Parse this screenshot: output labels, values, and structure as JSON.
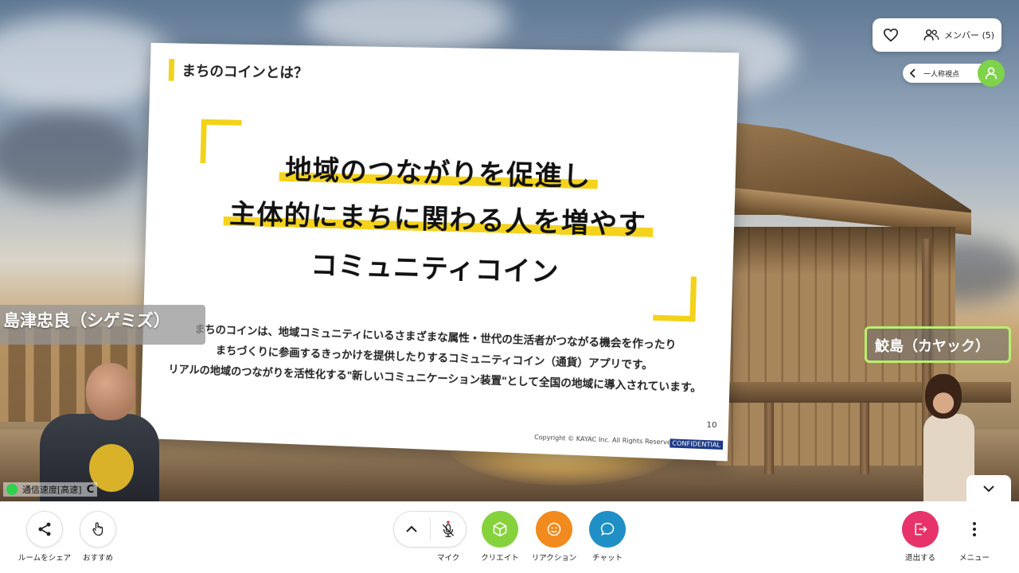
{
  "slide": {
    "tag": "まちのコインとは？",
    "headline_1": "地域のつながりを促進し",
    "headline_2": "主体的にまちに関わる人を増やす",
    "headline_3": "コミュニティコイン",
    "desc_1": "まちのコインは、地域コミュニティにいるさまざまな属性・世代の生活者がつながる機会を作ったり",
    "desc_2": "まちづくりに参画するきっかけを提供したりするコミュニティコイン（通貨）アプリです。",
    "desc_3": "リアルの地域のつながりを活性化する\"新しいコミュニケーション装置\"として全国の地域に導入されています。",
    "page_number": "10",
    "copyright": "Copyright © KAYAC Inc. All Rights Reserved.",
    "confidential": "CONFIDENTIAL"
  },
  "avatars": {
    "left_name": "島津忠良（シゲミズ）",
    "right_name": "鮫島（カヤック）"
  },
  "top_panel": {
    "members_label": "メンバー (5)",
    "view_label": "一人称視点"
  },
  "network": {
    "label": "通信速度[高速]",
    "reconnect_glyph": "C"
  },
  "toolbar": {
    "share_label": "ルームをシェア",
    "recommend_label": "おすすめ",
    "mic_label": "マイク",
    "create_label": "クリエイト",
    "reaction_label": "リアクション",
    "chat_label": "チャット",
    "exit_label": "退出する",
    "menu_label": "メニュー"
  },
  "colors": {
    "create": "#86d23c",
    "reaction": "#f28a1d",
    "chat": "#1f8fc6",
    "exit": "#e8336a",
    "highlight": "#f5d31c",
    "first_person": "#7ed34a"
  }
}
